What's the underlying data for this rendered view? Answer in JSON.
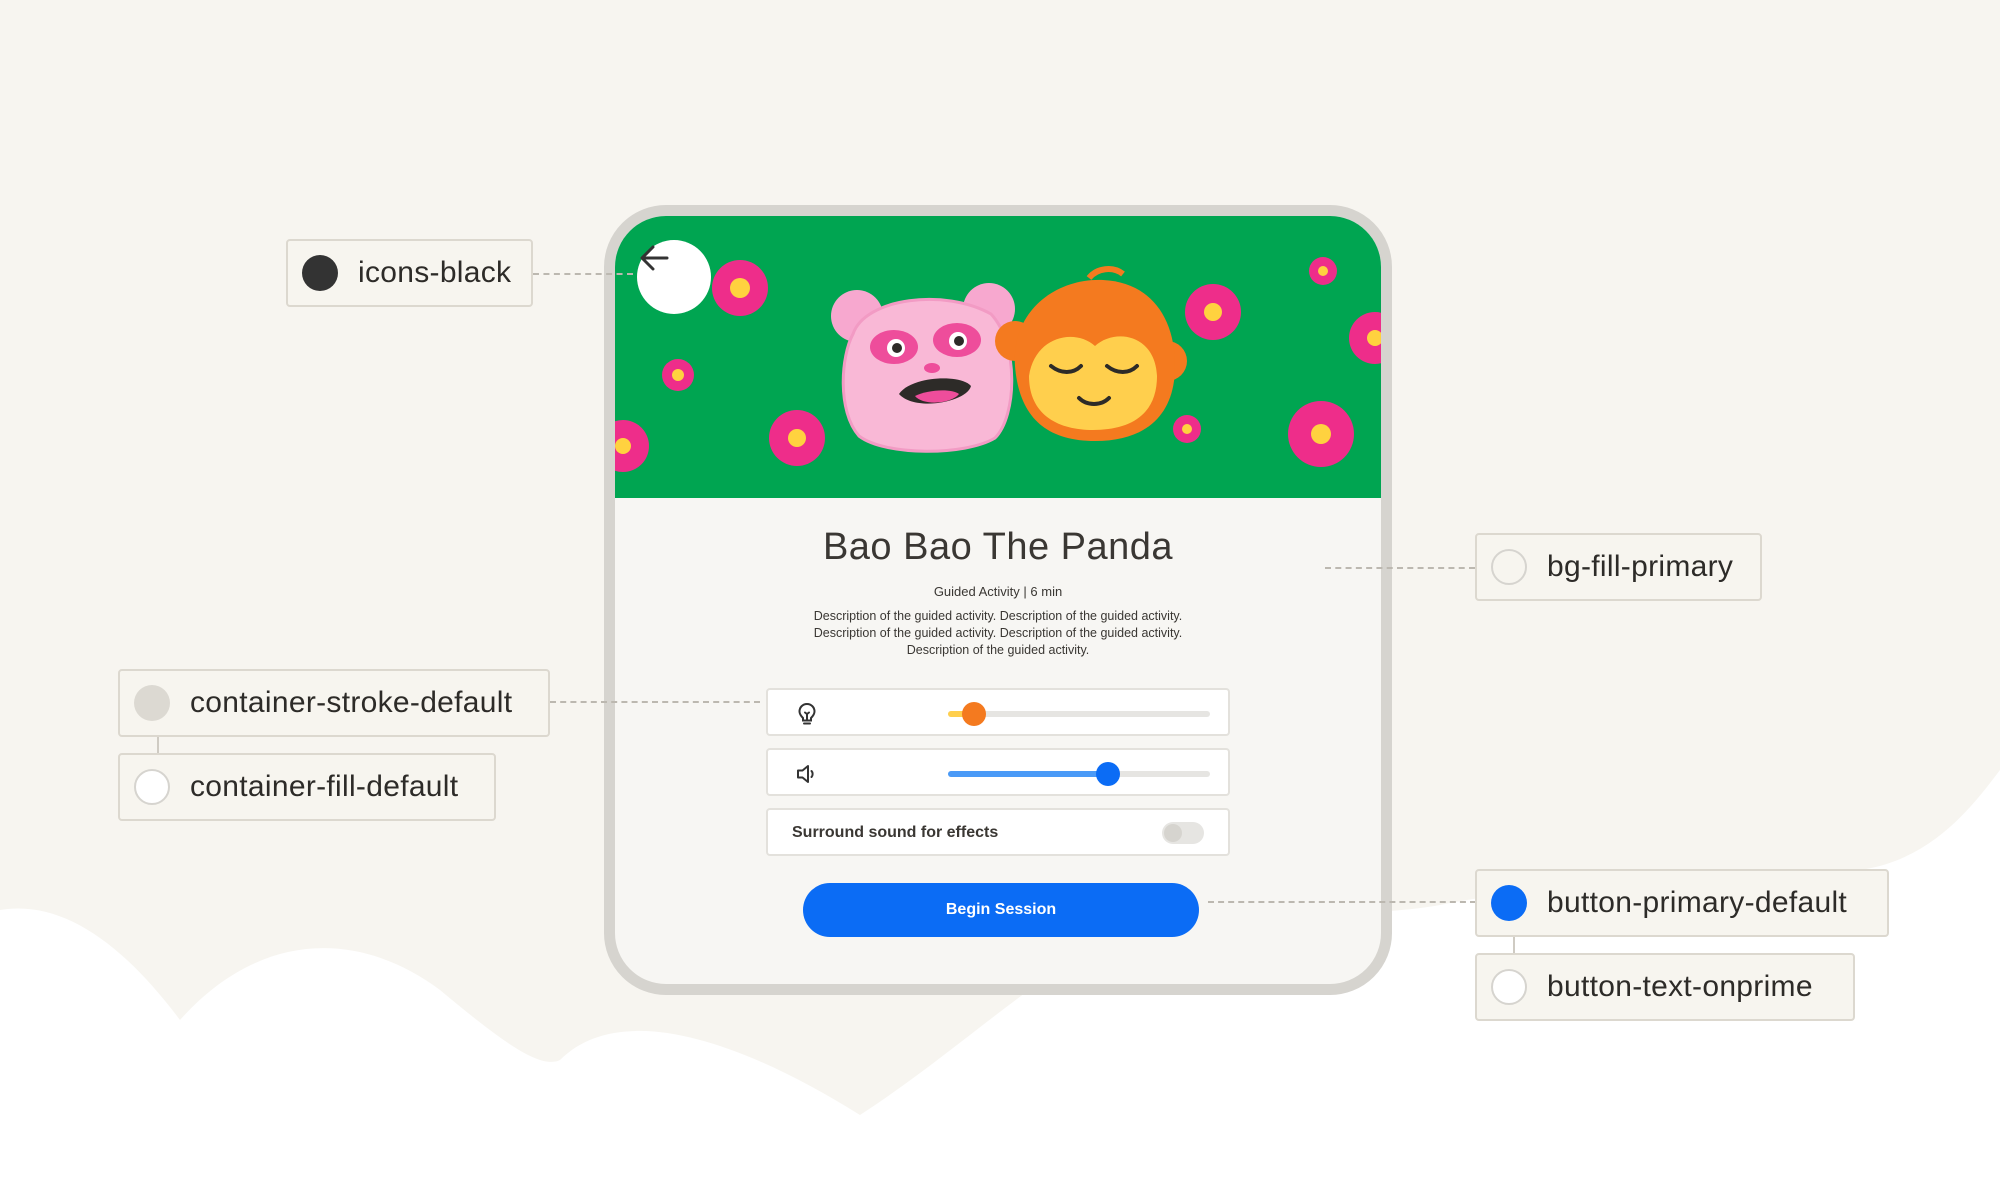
{
  "colors": {
    "page_bg": "#f7f5f0",
    "banner_green": "#00a551",
    "icons_black": "#333333",
    "bg_fill_primary": "#ffffff",
    "container_stroke_default": "#e3e1dc",
    "container_fill_default": "#ffffff",
    "button_primary_default": "#0b6cf5",
    "button_text_onprime": "#ffffff",
    "brightness_accent": "#f47a1f",
    "volume_accent": "#0b6cf5"
  },
  "screen": {
    "back_icon": "arrow-left-icon",
    "title": "Bao Bao The Panda",
    "subtitle": "Guided Activity | 6 min",
    "description": "Description of the guided activity. Description of the guided activity. Description of the guided activity. Description of the guided activity. Description of the guided activity.",
    "brightness": {
      "icon": "lightbulb-icon",
      "value": 0.1
    },
    "volume": {
      "icon": "speaker-icon",
      "value": 0.61
    },
    "surround_toggle": {
      "label": "Surround sound for effects",
      "on": false
    },
    "begin_button": "Begin Session"
  },
  "annotations": {
    "icons_black": "icons-black",
    "bg_fill_primary": "bg-fill-primary",
    "container_stroke_default": "container-stroke-default",
    "container_fill_default": "container-fill-default",
    "button_primary_default": "button-primary-default",
    "button_text_onprime": "button-text-onprime"
  }
}
